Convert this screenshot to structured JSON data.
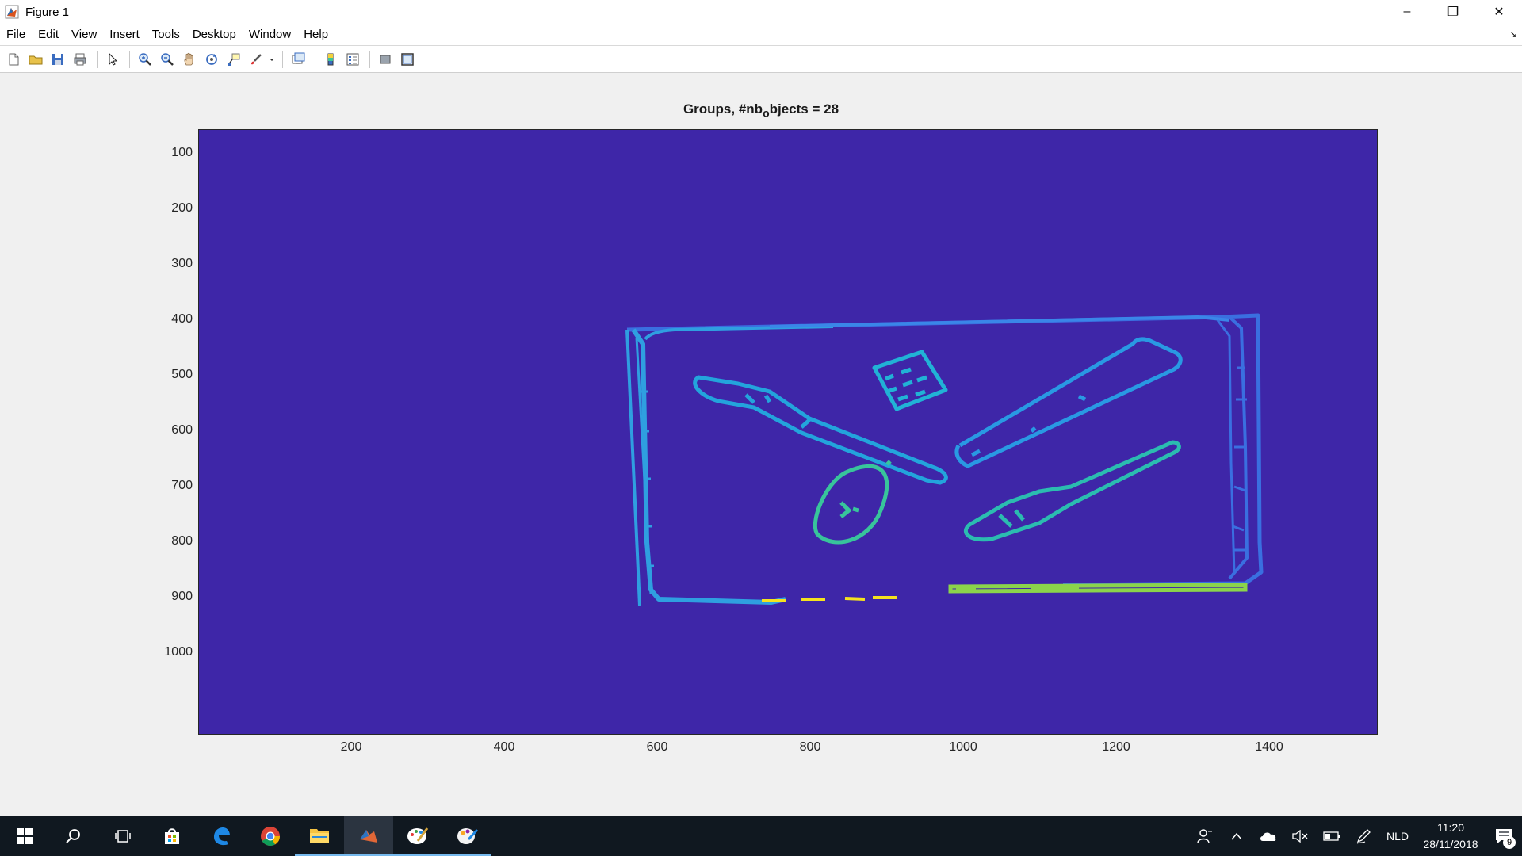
{
  "window": {
    "title": "Figure 1",
    "minimize_glyph": "–",
    "restore_glyph": "❐",
    "close_glyph": "✕"
  },
  "menu": {
    "items": [
      "File",
      "Edit",
      "View",
      "Insert",
      "Tools",
      "Desktop",
      "Window",
      "Help"
    ],
    "corner_glyph": "↘"
  },
  "toolbar": {
    "buttons": [
      "new-figure-icon",
      "open-icon",
      "save-icon",
      "print-icon",
      "edit-plot-arrow-icon",
      "zoom-in-icon",
      "zoom-out-icon",
      "pan-hand-icon",
      "rotate-3d-icon",
      "data-cursor-icon",
      "brush-icon",
      "link-plot-icon",
      "insert-colorbar-icon",
      "insert-legend-icon",
      "hide-plot-tools-icon",
      "show-plot-tools-icon"
    ]
  },
  "plot": {
    "title_main": "Groups, #nb",
    "title_sub": "o",
    "title_rest": "bjects = 28",
    "background_color": "#3e26a8",
    "colors": {
      "frame": "#2f9fe0",
      "frame_dark": "#3a6fe0",
      "objects": "#20b0d6",
      "brush": "#27c0c0",
      "mouse": "#3cc59a",
      "bottom_bar": "#8bd44b",
      "yellow": "#f5e31e"
    },
    "y_ticks": [
      "100",
      "200",
      "300",
      "400",
      "500",
      "600",
      "700",
      "800",
      "900",
      "1000"
    ],
    "x_ticks": [
      "200",
      "400",
      "600",
      "800",
      "1000",
      "1200",
      "1400"
    ]
  },
  "taskbar": {
    "apps": [
      "windows-start-icon",
      "search-icon",
      "task-view-icon",
      "store-icon",
      "edge-icon",
      "chrome-icon",
      "file-explorer-icon",
      "matlab-icon",
      "paint-icon",
      "paint-3d-icon"
    ],
    "language": "NLD",
    "time": "11:20",
    "date": "28/11/2018",
    "notification_count": "9"
  }
}
